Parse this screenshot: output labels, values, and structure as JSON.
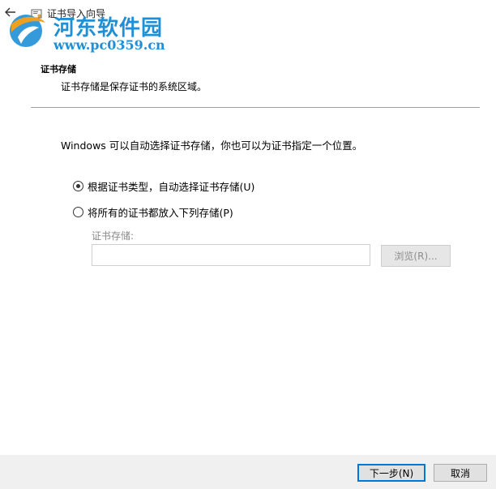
{
  "window": {
    "title": "证书导入向导"
  },
  "watermark": {
    "text": "河东软件园",
    "url": "www.pc0359.cn"
  },
  "header": {
    "heading": "证书存储",
    "description": "证书存储是保存证书的系统区域。"
  },
  "main": {
    "intro": "Windows 可以自动选择证书存储，你也可以为证书指定一个位置。",
    "options": [
      {
        "label": "根据证书类型，自动选择证书存储(U)",
        "selected": true
      },
      {
        "label": "将所有的证书都放入下列存储(P)",
        "selected": false
      }
    ],
    "store_label": "证书存储:",
    "store_value": "",
    "browse_label": "浏览(R)..."
  },
  "footer": {
    "next_label": "下一步(N)",
    "cancel_label": "取消"
  },
  "colors": {
    "accent": "#0078d7",
    "watermark": "#1f8fd6",
    "footer_bg": "#f0f0f0"
  },
  "icons": {
    "back": "back-arrow-icon",
    "wizard": "certificate-wizard-icon",
    "watermark_logo": "watermark-logo-icon"
  }
}
